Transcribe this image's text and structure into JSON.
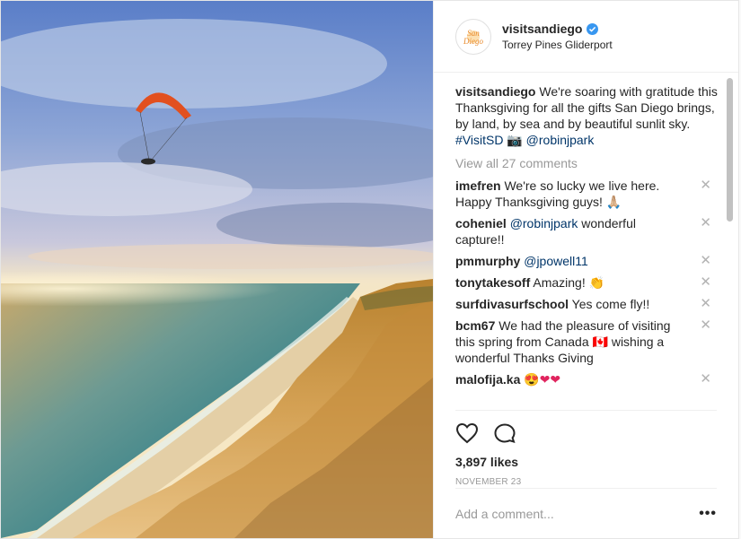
{
  "post": {
    "username": "visitsandiego",
    "location": "Torrey Pines Gliderport",
    "caption_user": "visitsandiego",
    "caption_text": "We're soaring with gratitude this Thanksgiving for all the gifts San Diego brings, by land, by sea and by beautiful sunlit sky.",
    "caption_hashtag": "#VisitSD",
    "caption_emoji": "📷",
    "caption_mention": "@robinjpark",
    "view_all": "View all 27 comments",
    "likes": "3,897 likes",
    "date": "NOVEMBER 23",
    "add_comment_placeholder": "Add a comment...",
    "more_options": "•••"
  },
  "comments": [
    {
      "user": "imefren",
      "text": "We're so lucky we live here. Happy Thanksgiving guys! 🙏🏼",
      "mention": ""
    },
    {
      "user": "coheniel",
      "text": "wonderful capture!!",
      "mention": "@robinjpark"
    },
    {
      "user": "pmmurphy",
      "text": "",
      "mention": "@jpowell11"
    },
    {
      "user": "tonytakesoff",
      "text": "Amazing! 👏",
      "mention": ""
    },
    {
      "user": "surfdivasurfschool",
      "text": "Yes come fly!!",
      "mention": ""
    },
    {
      "user": "bcm67",
      "text": "We had the pleasure of visiting this spring from Canada 🇨🇦 wishing a wonderful Thanks Giving",
      "mention": ""
    },
    {
      "user": "malofija.ka",
      "text": "😍❤❤",
      "mention": ""
    }
  ],
  "icons": {
    "like": "heart-icon",
    "comment": "comment-bubble-icon",
    "verified": "verified-badge-icon",
    "close": "close-icon"
  },
  "colors": {
    "link": "#003569",
    "verified": "#3897f0",
    "muted": "#999999"
  }
}
